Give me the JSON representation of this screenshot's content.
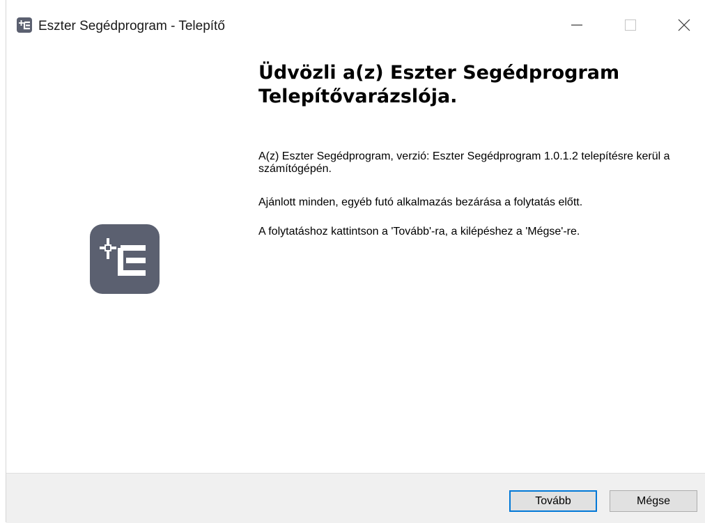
{
  "window": {
    "title": "Eszter Segédprogram - Telepítő",
    "controls": {
      "minimize_icon": "minimize-icon",
      "maximize_icon": "maximize-icon",
      "close_icon": "close-icon"
    }
  },
  "welcome": {
    "heading": "Üdvözli a(z) Eszter Segédprogram Telepítővarázslója.",
    "paragraphs": [
      "A(z) Eszter Segédprogram, verzió: Eszter Segédprogram 1.0.1.2 telepítésre kerül a számítógépén.",
      "Ajánlott minden, egyéb futó alkalmazás bezárása a folytatás előtt.",
      "A folytatáshoz kattintson a 'Tovább'-ra, a kilépéshez a 'Mégse'-re."
    ],
    "logo_icon": "app-logo-icon"
  },
  "buttons": {
    "next_label": "Tovább",
    "cancel_label": "Mégse"
  },
  "colors": {
    "logo": "#5b6070",
    "accent": "#0078d7",
    "footer_bg": "#f0f0f0"
  }
}
